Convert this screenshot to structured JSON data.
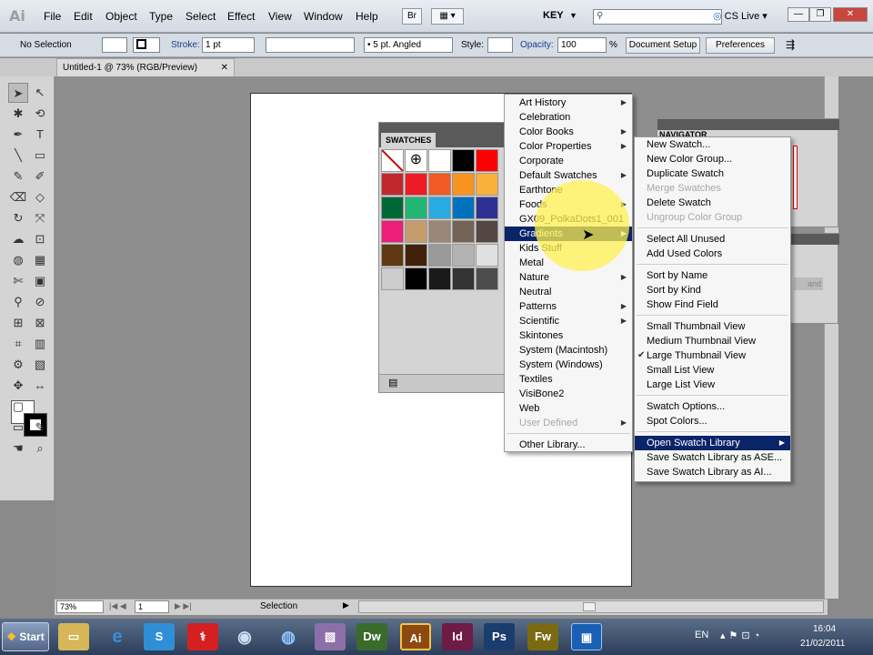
{
  "app": {
    "logo": "Ai"
  },
  "menubar": {
    "items": [
      "File",
      "Edit",
      "Object",
      "Type",
      "Select",
      "Effect",
      "View",
      "Window",
      "Help"
    ],
    "bridge_label": "Br",
    "workspace": "KEY",
    "cs_live": "CS Live"
  },
  "control": {
    "selection": "No Selection",
    "stroke_label": "Stroke:",
    "stroke_value": "1 pt",
    "brush": "5 pt. Angled",
    "style_label": "Style:",
    "opacity_label": "Opacity:",
    "opacity_value": "100",
    "percent": "%",
    "doc_setup": "Document Setup",
    "preferences": "Preferences"
  },
  "document": {
    "tab_title": "Untitled-1 @ 73% (RGB/Preview)"
  },
  "swatches": {
    "title": "SWATCHES",
    "colors": [
      "#ffffff",
      "#ffffff",
      "#ffffff",
      "#000000",
      "#ff0000",
      "#c1272d",
      "#ed1c24",
      "#f15a24",
      "#f7931e",
      "#fbb03b",
      "#006837",
      "#22b573",
      "#29abe2",
      "#0071bc",
      "#2e3192",
      "#ed1e79",
      "#c69c6d",
      "#998675",
      "#736357",
      "#534741",
      "#603813",
      "#42210b",
      "#999999",
      "#b3b3b3",
      "#e0e0e0",
      "#cccccc",
      "#000000",
      "#1a1a1a",
      "#333333",
      "#4d4d4d"
    ]
  },
  "libraries_menu": {
    "items": [
      {
        "label": "Art History",
        "sub": true
      },
      {
        "label": "Celebration",
        "sub": false
      },
      {
        "label": "Color Books",
        "sub": true
      },
      {
        "label": "Color Properties",
        "sub": true
      },
      {
        "label": "Corporate",
        "sub": false
      },
      {
        "label": "Default Swatches",
        "sub": true
      },
      {
        "label": "Earthtone",
        "sub": false
      },
      {
        "label": "Foods",
        "sub": true
      },
      {
        "label": "GX09_PolkaDots1_001",
        "sub": false
      },
      {
        "label": "Gradients",
        "sub": true,
        "highlighted": true
      },
      {
        "label": "Kids Stuff",
        "sub": false
      },
      {
        "label": "Metal",
        "sub": false
      },
      {
        "label": "Nature",
        "sub": true
      },
      {
        "label": "Neutral",
        "sub": false
      },
      {
        "label": "Patterns",
        "sub": true
      },
      {
        "label": "Scientific",
        "sub": true
      },
      {
        "label": "Skintones",
        "sub": false
      },
      {
        "label": "System (Macintosh)",
        "sub": false
      },
      {
        "label": "System (Windows)",
        "sub": false
      },
      {
        "label": "Textiles",
        "sub": false
      },
      {
        "label": "VisiBone2",
        "sub": false
      },
      {
        "label": "Web",
        "sub": false
      },
      {
        "label": "User Defined",
        "sub": true,
        "disabled": true
      }
    ],
    "other": "Other Library..."
  },
  "panel_menu": {
    "groups": [
      [
        {
          "label": "New Swatch..."
        },
        {
          "label": "New Color Group..."
        },
        {
          "label": "Duplicate Swatch"
        },
        {
          "label": "Merge Swatches",
          "disabled": true
        },
        {
          "label": "Delete Swatch"
        },
        {
          "label": "Ungroup Color Group",
          "disabled": true
        }
      ],
      [
        {
          "label": "Select All Unused"
        },
        {
          "label": "Add Used Colors"
        }
      ],
      [
        {
          "label": "Sort by Name"
        },
        {
          "label": "Sort by Kind"
        },
        {
          "label": "Show Find Field"
        }
      ],
      [
        {
          "label": "Small Thumbnail View"
        },
        {
          "label": "Medium Thumbnail View"
        },
        {
          "label": "Large Thumbnail View",
          "checked": true
        },
        {
          "label": "Small List View"
        },
        {
          "label": "Large List View"
        }
      ],
      [
        {
          "label": "Swatch Options..."
        },
        {
          "label": "Spot Colors..."
        }
      ],
      [
        {
          "label": "Open Swatch Library",
          "highlighted": true,
          "sub": true
        },
        {
          "label": "Save Swatch Library as ASE..."
        },
        {
          "label": "Save Swatch Library as AI..."
        }
      ]
    ]
  },
  "navigator": {
    "title": "NAVIGATOR",
    "brand_fragment": "and"
  },
  "status": {
    "zoom": "73%",
    "page": "1",
    "tool": "Selection"
  },
  "taskbar": {
    "start": "Start",
    "apps": [
      "Dw",
      "Ai",
      "Id",
      "Ps",
      "Fw"
    ],
    "lang": "EN",
    "time": "16:04",
    "date": "21/02/2011"
  }
}
